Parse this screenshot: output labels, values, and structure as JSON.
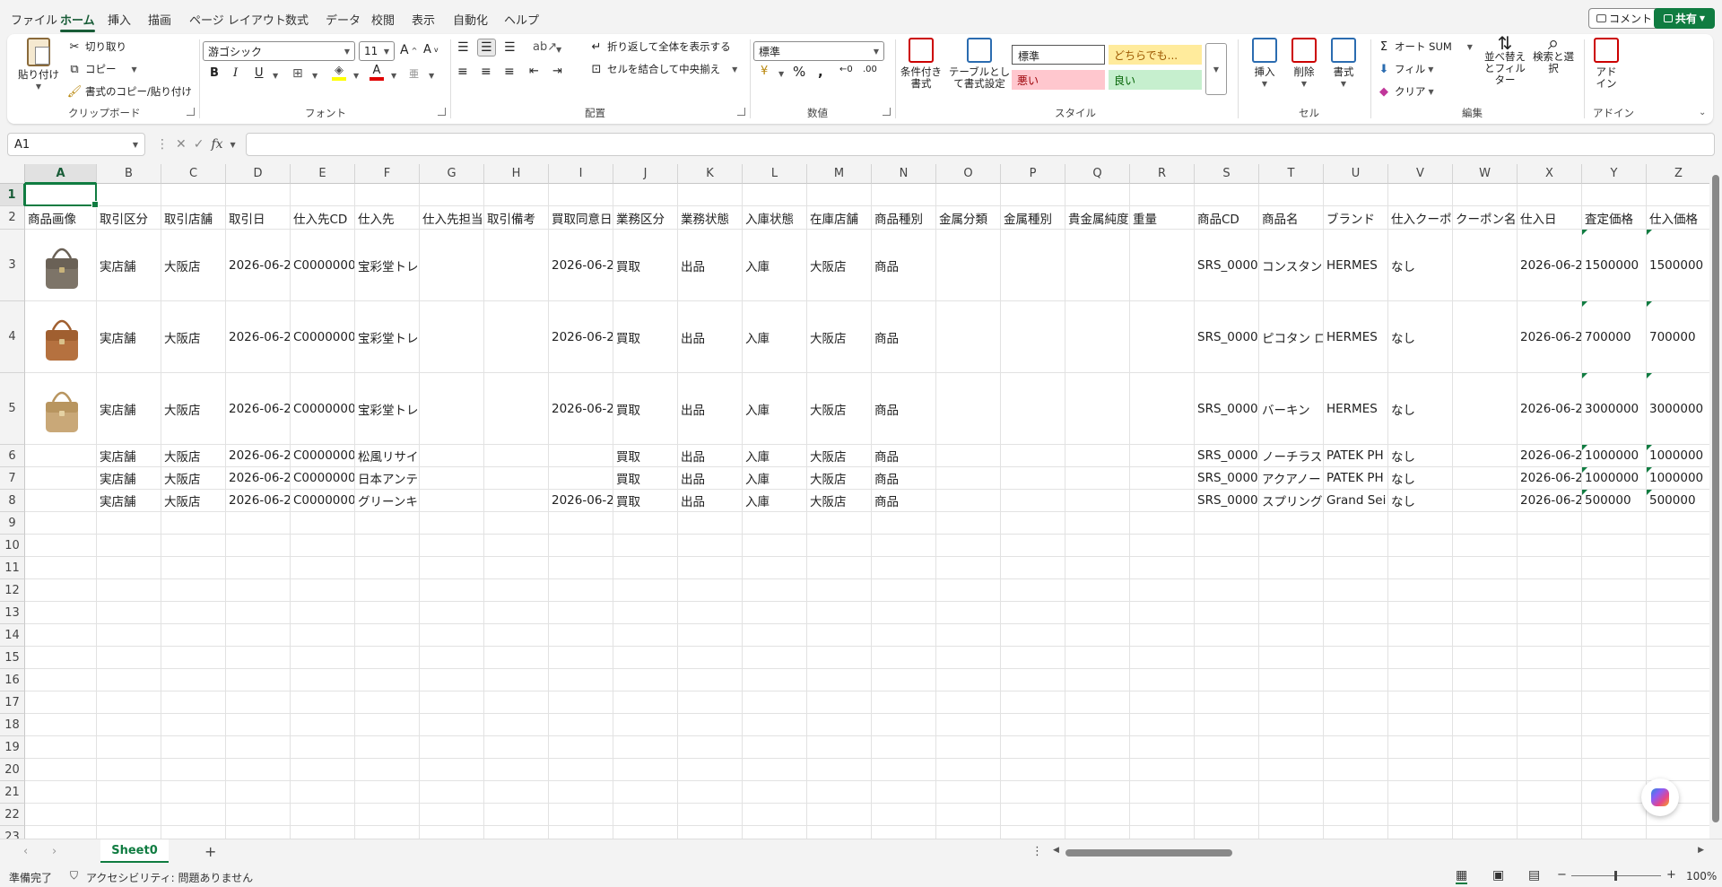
{
  "menu": {
    "items": [
      "ファイル",
      "ホーム",
      "挿入",
      "描画",
      "ページ レイアウト",
      "数式",
      "データ",
      "校閲",
      "表示",
      "自動化",
      "ヘルプ"
    ],
    "active": "ホーム",
    "comment_label": "コメント",
    "share_label": "共有"
  },
  "ribbon": {
    "clipboard": {
      "group_label": "クリップボード",
      "paste_label": "貼り付け",
      "cut_label": "切り取り",
      "copy_label": "コピー",
      "format_painter_label": "書式のコピー/貼り付け"
    },
    "font": {
      "group_label": "フォント",
      "font_name": "游ゴシック",
      "font_size": "11"
    },
    "alignment": {
      "group_label": "配置",
      "wrap_label": "折り返して全体を表示する",
      "merge_label": "セルを結合して中央揃え"
    },
    "number": {
      "group_label": "数値",
      "format": "標準"
    },
    "styles": {
      "group_label": "スタイル",
      "conditional_label": "条件付き書式",
      "table_label": "テーブルとして書式設定",
      "normal": "標準",
      "neutral": "どちらでも...",
      "bad": "悪い",
      "good": "良い"
    },
    "cells": {
      "group_label": "セル",
      "insert_label": "挿入",
      "delete_label": "削除",
      "format_label": "書式"
    },
    "editing": {
      "group_label": "編集",
      "autosum_label": "オート SUM",
      "fill_label": "フィル",
      "clear_label": "クリア",
      "sort_label": "並べ替えとフィルター",
      "find_label": "検索と選択"
    },
    "addins": {
      "group_label": "アドイン",
      "addin_label": "アドイン"
    }
  },
  "formula_bar": {
    "name_box": "A1",
    "fx": "fx",
    "formula": ""
  },
  "sheet": {
    "columns": [
      "A",
      "B",
      "C",
      "D",
      "E",
      "F",
      "G",
      "H",
      "I",
      "J",
      "K",
      "L",
      "M",
      "N",
      "O",
      "P",
      "Q",
      "R",
      "S",
      "T",
      "U",
      "V",
      "W",
      "X",
      "Y",
      "Z"
    ],
    "rows": [
      "1",
      "2",
      "3",
      "4",
      "5",
      "6",
      "7",
      "8",
      "9",
      "10",
      "11",
      "12",
      "13",
      "14",
      "15",
      "16",
      "17",
      "18",
      "19",
      "20",
      "21",
      "22",
      "23"
    ],
    "headers": [
      "商品画像",
      "取引区分",
      "取引店舗",
      "取引日",
      "仕入先CD",
      "仕入先",
      "仕入先担当",
      "取引備考",
      "買取同意日",
      "業務区分",
      "業務状態",
      "入庫状態",
      "在庫店舗",
      "商品種別",
      "金属分類",
      "金属種別",
      "貴金属純度",
      "重量",
      "商品CD",
      "商品名",
      "ブランド",
      "仕入クーポン",
      "クーポン名",
      "仕入日",
      "査定価格",
      "仕入価格"
    ],
    "data_rows": [
      [
        "",
        "実店舗",
        "大阪店",
        "2026-06-2",
        "C0000000",
        "宝彩堂トレーディング",
        "",
        "",
        "2026-06-2",
        "買取",
        "出品",
        "入庫",
        "大阪店",
        "商品",
        "",
        "",
        "",
        "",
        "SRS_0000",
        "コンスタンス",
        "HERMES",
        "なし",
        "",
        "2026-06-2",
        "1500000",
        "1500000"
      ],
      [
        "",
        "実店舗",
        "大阪店",
        "2026-06-2",
        "C0000000",
        "宝彩堂トレーディング",
        "",
        "",
        "2026-06-2",
        "買取",
        "出品",
        "入庫",
        "大阪店",
        "商品",
        "",
        "",
        "",
        "",
        "SRS_0000",
        "ピコタン ロック",
        "HERMES",
        "なし",
        "",
        "2026-06-2",
        "700000",
        "700000"
      ],
      [
        "",
        "実店舗",
        "大阪店",
        "2026-06-2",
        "C0000000",
        "宝彩堂トレーディング",
        "",
        "",
        "2026-06-2",
        "買取",
        "出品",
        "入庫",
        "大阪店",
        "商品",
        "",
        "",
        "",
        "",
        "SRS_0000",
        "バーキン",
        "HERMES",
        "なし",
        "",
        "2026-06-2",
        "3000000",
        "3000000"
      ],
      [
        "",
        "実店舗",
        "大阪店",
        "2026-06-2",
        "C0000000",
        "松風リサイクル流通",
        "",
        "",
        "",
        "買取",
        "出品",
        "入庫",
        "大阪店",
        "商品",
        "",
        "",
        "",
        "",
        "SRS_0000",
        "ノーチラス",
        "PATEK PH",
        "なし",
        "",
        "2026-06-2",
        "1000000",
        "1000000"
      ],
      [
        "",
        "実店舗",
        "大阪店",
        "2026-06-2",
        "C0000000",
        "日本アンティークリンク",
        "",
        "",
        "",
        "買取",
        "出品",
        "入庫",
        "大阪店",
        "商品",
        "",
        "",
        "",
        "",
        "SRS_0000",
        "アクアノート",
        "PATEK PH",
        "なし",
        "",
        "2026-06-2",
        "1000000",
        "1000000"
      ],
      [
        "",
        "実店舗",
        "大阪店",
        "2026-06-2",
        "C0000000",
        "グリーンキャピタル商事",
        "",
        "",
        "2026-06-2",
        "買取",
        "出品",
        "入庫",
        "大阪店",
        "商品",
        "",
        "",
        "",
        "",
        "SRS_0000",
        "スプリング",
        "Grand Sei",
        "なし",
        "",
        "2026-06-2",
        "500000",
        "500000"
      ]
    ],
    "images": [
      "bag-grey-icon",
      "bag-orange-icon",
      "bag-tan-icon"
    ]
  },
  "tabs": {
    "sheet_name": "Sheet0",
    "add_label": "+"
  },
  "status": {
    "ready": "準備完了",
    "accessibility": "アクセシビリティ: 問題ありません",
    "zoom": "100%"
  },
  "colors": {
    "accent": "#107c41",
    "bad_bg": "#ffc7ce",
    "good_bg": "#c6efce",
    "neutral_bg": "#ffeb9c"
  }
}
